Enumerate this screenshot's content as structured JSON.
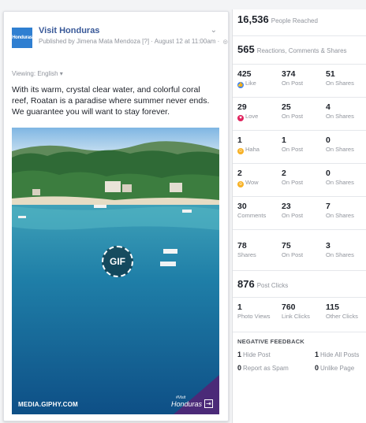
{
  "post": {
    "page_name": "Visit Honduras",
    "avatar_text": "Honduras",
    "published_by": "Published by Jimena Mata Mendoza [?] · August 12 at 11:00am ·",
    "viewing": "Viewing: English ▾",
    "text": "With its warm, crystal clear water, and colorful coral reef, Roatan is a paradise where summer never ends. We guarantee you will want to stay forever.",
    "media": {
      "badge": "GIF",
      "source_label": "MEDIA.GIPHY.COM",
      "brand_logo": "Honduras",
      "brand_sub": "#Visit"
    }
  },
  "insights": {
    "people_reached": {
      "value": "16,536",
      "label": "People Reached"
    },
    "engagement": {
      "value": "565",
      "label": "Reactions, Comments & Shares"
    },
    "rows": [
      {
        "icon": "like-icon",
        "icon_color": "#3b82f6",
        "total": "425",
        "total_label": "Like",
        "on_post": "374",
        "on_post_label": "On Post",
        "on_shares": "51",
        "on_shares_label": "On Shares"
      },
      {
        "icon": "love-icon",
        "icon_color": "#e0245e",
        "total": "29",
        "total_label": "Love",
        "on_post": "25",
        "on_post_label": "On Post",
        "on_shares": "4",
        "on_shares_label": "On Shares"
      },
      {
        "icon": "haha-icon",
        "icon_color": "#f7b125",
        "total": "1",
        "total_label": "Haha",
        "on_post": "1",
        "on_post_label": "On Post",
        "on_shares": "0",
        "on_shares_label": "On Shares"
      },
      {
        "icon": "wow-icon",
        "icon_color": "#f7b125",
        "total": "2",
        "total_label": "Wow",
        "on_post": "2",
        "on_post_label": "On Post",
        "on_shares": "0",
        "on_shares_label": "On Shares"
      },
      {
        "icon": "",
        "total": "30",
        "total_label": "Comments",
        "on_post": "23",
        "on_post_label": "On Post",
        "on_shares": "7",
        "on_shares_label": "On Shares"
      },
      {
        "icon": "",
        "total": "78",
        "total_label": "Shares",
        "on_post": "75",
        "on_post_label": "On Post",
        "on_shares": "3",
        "on_shares_label": "On Shares"
      }
    ],
    "post_clicks": {
      "value": "876",
      "label": "Post Clicks"
    },
    "clicks": [
      {
        "value": "1",
        "label": "Photo Views"
      },
      {
        "value": "760",
        "label": "Link Clicks"
      },
      {
        "value": "115",
        "label": "Other Clicks"
      }
    ],
    "negative_feedback": {
      "title": "NEGATIVE FEEDBACK",
      "items": [
        {
          "value": "1",
          "label": "Hide Post"
        },
        {
          "value": "1",
          "label": "Hide All Posts"
        },
        {
          "value": "0",
          "label": "Report as Spam"
        },
        {
          "value": "0",
          "label": "Unlike Page"
        }
      ]
    }
  }
}
